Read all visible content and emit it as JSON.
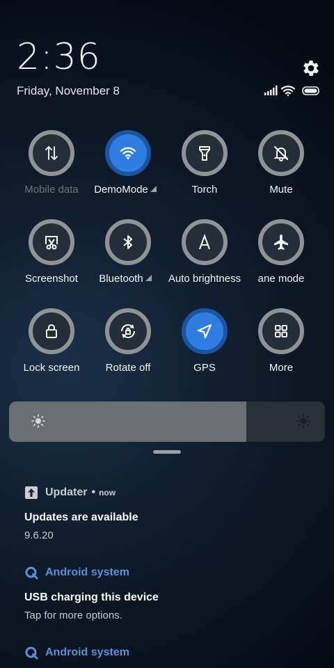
{
  "header": {
    "time": "2:36",
    "date": "Friday, November 8"
  },
  "status_icons": [
    "signal-icon",
    "wifi-icon",
    "battery-icon"
  ],
  "tiles": [
    {
      "label": "Mobile data",
      "icon": "mobile-data-icon",
      "state": "disabled"
    },
    {
      "label": "DemoMode",
      "icon": "wifi-icon",
      "state": "on",
      "expandable": true
    },
    {
      "label": "Torch",
      "icon": "torch-icon",
      "state": "off"
    },
    {
      "label": "Mute",
      "icon": "bell-off-icon",
      "state": "off"
    },
    {
      "label": "Screenshot",
      "icon": "screenshot-icon",
      "state": "off"
    },
    {
      "label": "Bluetooth",
      "icon": "bluetooth-icon",
      "state": "off",
      "expandable": true
    },
    {
      "label": "Auto brightness",
      "icon": "auto-brightness-icon",
      "state": "off"
    },
    {
      "label": "ane mode",
      "icon": "airplane-icon",
      "state": "off"
    },
    {
      "label": "Lock screen",
      "icon": "lock-icon",
      "state": "off"
    },
    {
      "label": "Rotate off",
      "icon": "rotate-lock-icon",
      "state": "off"
    },
    {
      "label": "GPS",
      "icon": "location-arrow-icon",
      "state": "on"
    },
    {
      "label": "More",
      "icon": "grid-icon",
      "state": "off"
    }
  ],
  "brightness": {
    "level": 0.75
  },
  "notifications": [
    {
      "app": "Updater",
      "time": "now",
      "title": "Updates are available",
      "text": "9.6.20"
    },
    {
      "app": "Android system",
      "title": "USB charging this device",
      "text": "Tap for more options."
    },
    {
      "app": "Android system"
    }
  ],
  "colors": {
    "accent": "#2f7de0",
    "ring_off": "#8f9396",
    "ring_on": "#1d54a0",
    "android_app": "#5b8fd8"
  }
}
